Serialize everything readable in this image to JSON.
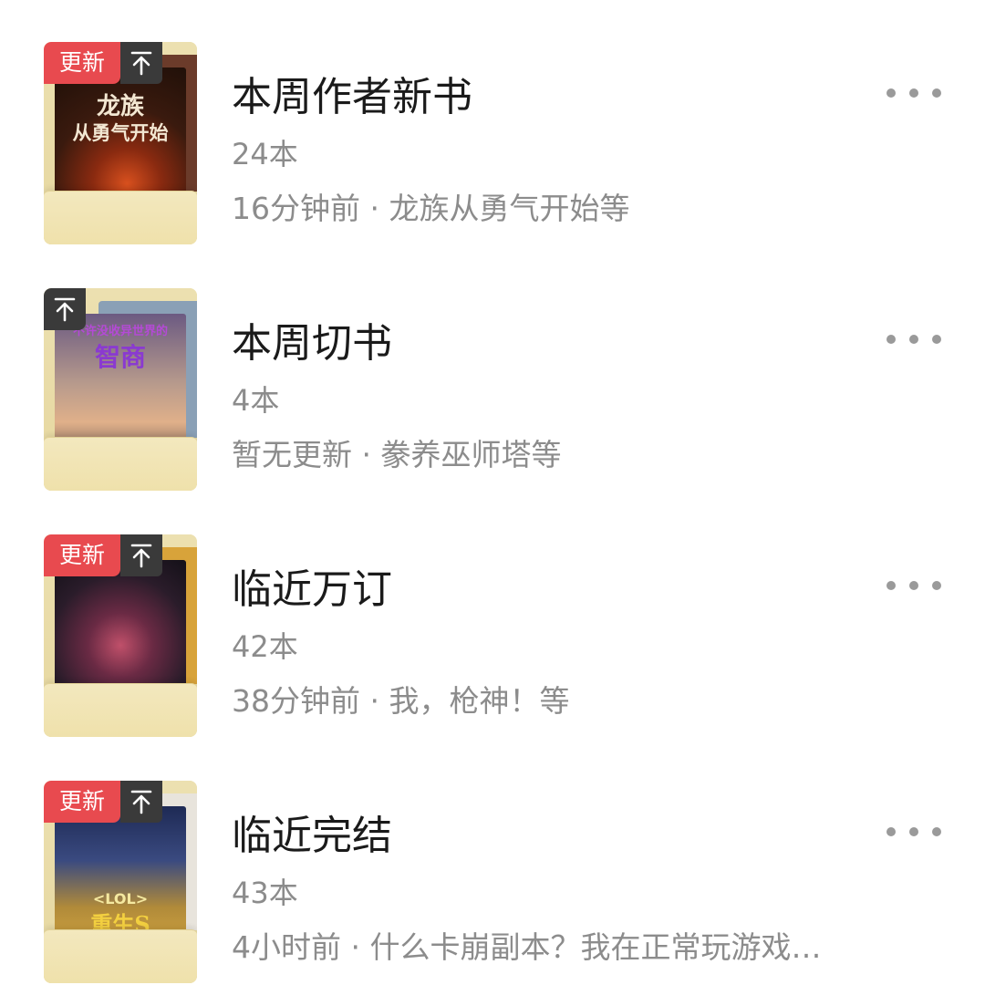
{
  "lists": [
    {
      "title": "本周作者新书",
      "count": "24本",
      "updated": "16分钟前 · 龙族从勇气开始等",
      "update_badge": "更新",
      "has_update": true,
      "cover_title_line1": "龙族",
      "cover_title_line2": "从勇气开始",
      "cover_colors": [
        "#3b1a0e",
        "#b8411a"
      ]
    },
    {
      "title": "本周切书",
      "count": "4本",
      "updated": "暂无更新 · 豢养巫师塔等",
      "update_badge": "",
      "has_update": false,
      "cover_title_line1": "不许没收异世界的",
      "cover_title_line2": "智商",
      "cover_colors": [
        "#5b4e6e",
        "#c79a7a"
      ]
    },
    {
      "title": "临近万订",
      "count": "42本",
      "updated": "38分钟前 · 我，枪神！等",
      "update_badge": "更新",
      "has_update": true,
      "cover_title_line1": "",
      "cover_title_line2": "",
      "cover_colors": [
        "#2a2030",
        "#7a3a4a"
      ]
    },
    {
      "title": "临近完结",
      "count": "43本",
      "updated": "4小时前 · 什么卡崩副本？我在正常玩游戏…",
      "update_badge": "更新",
      "has_update": true,
      "cover_title_line1": "<LOL>",
      "cover_title_line2": "重生S",
      "cover_colors": [
        "#2a3a6a",
        "#d9a53a"
      ]
    }
  ],
  "icons": {
    "pin": "arrow-up-to-line-icon",
    "more": "more-horizontal-icon"
  },
  "colors": {
    "update_badge": "#e84a4f",
    "pin_badge": "#3a3a3a",
    "folder": "#efe3b6",
    "title": "#1a1a1a",
    "secondary": "#8c8c8c"
  }
}
